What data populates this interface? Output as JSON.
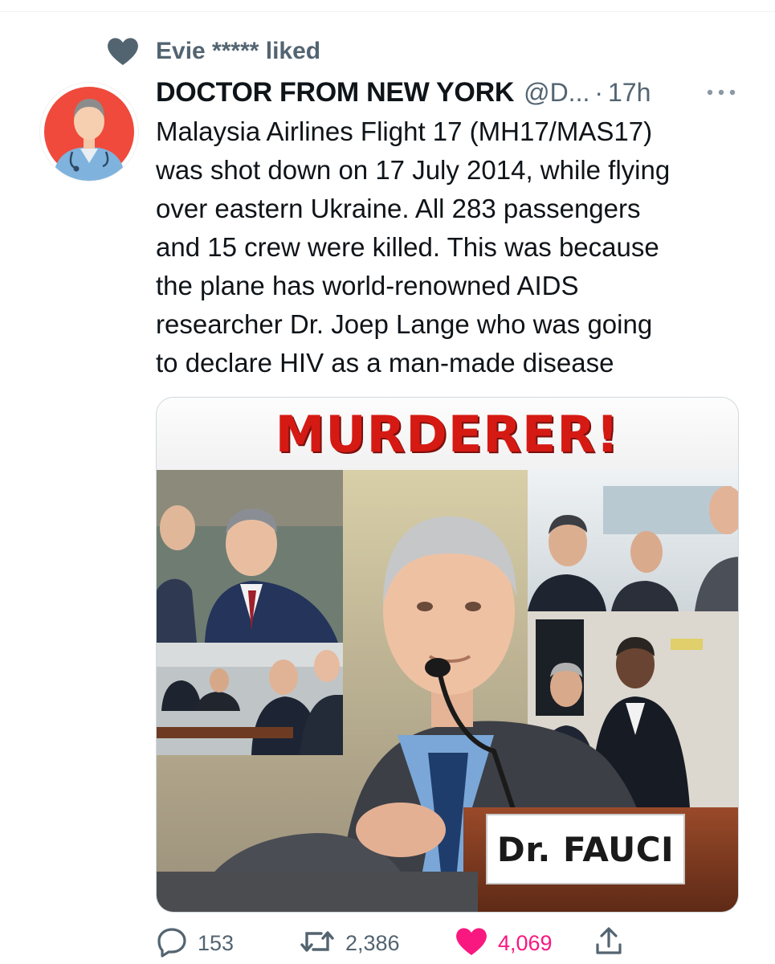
{
  "social_context": {
    "text": "Evie ***** liked",
    "icon": "heart-icon"
  },
  "tweet": {
    "display_name": "DOCTOR FROM NEW YORK",
    "handle": "@D...",
    "separator": "·",
    "time": "17h",
    "text": "Malaysia Airlines Flight 17 (MH17/MAS17)\nwas shot down on 17 July 2014, while flying\nover eastern Ukraine. All 283 passengers\nand 15 crew were killed. This was because\nthe plane has world-renowned AIDS\nresearcher Dr. Joep Lange who was going\nto declare HIV as a man-made disease",
    "media": {
      "banner_text": "MURDERER!",
      "nameplate_text": "Dr. FAUCI"
    }
  },
  "actions": {
    "reply_count": "153",
    "retweet_count": "2,386",
    "like_count": "4,069"
  },
  "colors": {
    "secondary_text": "#536471",
    "like_pink": "#f91880",
    "banner_red": "#d51a14",
    "avatar_red": "#ef4a3c"
  }
}
